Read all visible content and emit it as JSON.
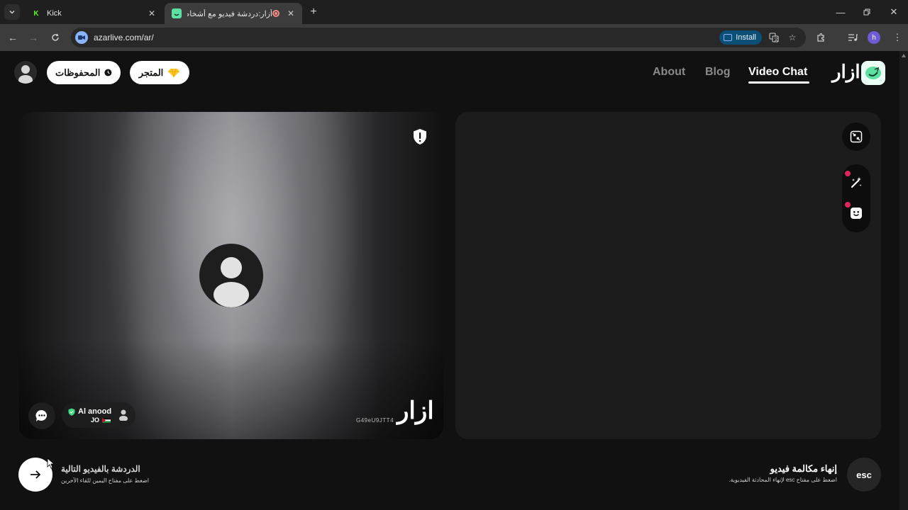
{
  "browser": {
    "tabs": [
      {
        "title": "Kick",
        "favicon_color": "#53fc18",
        "favicon_letter": "K",
        "active": false
      },
      {
        "title": "أزار:دردشة فيديو مع أشخاص",
        "favicon_color": "#5ee0a2",
        "favicon_letter": "",
        "active": true
      }
    ],
    "url": "azarlive.com/ar/",
    "install_label": "Install",
    "profile_initial": "h"
  },
  "header": {
    "saved_label": "المحفوظات",
    "store_label": "المتجر",
    "nav": {
      "about": "About",
      "blog": "Blog",
      "video_chat": "Video Chat"
    },
    "brand": "ازار",
    "accent": "#5ee0a2"
  },
  "remote": {
    "watermark": "ازار",
    "session_id": "G49eU9JTT4",
    "user": {
      "name": "Al anood",
      "country": "JO"
    }
  },
  "footer": {
    "next_title": "الدردشة بالفيديو التالية",
    "next_subtitle": "اضغط على مفتاح اليمين للقاء الآخرين",
    "esc_label": "esc",
    "end_title": "إنهاء مكالمة فيديو",
    "end_subtitle": "اضغط على مفتاح esc لإنهاء المحادثة الفيديوية."
  },
  "colors": {
    "notification_dot": "#e0245e",
    "page_bg": "#111111"
  }
}
